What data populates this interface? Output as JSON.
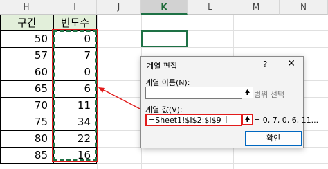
{
  "columns": [
    "H",
    "I",
    "J",
    "K",
    "L",
    "M",
    "N"
  ],
  "selected_column": "K",
  "table": {
    "header": {
      "interval": "구간",
      "frequency": "빈도수"
    },
    "rows": [
      {
        "interval": "50",
        "frequency": "0"
      },
      {
        "interval": "57",
        "frequency": "7"
      },
      {
        "interval": "60",
        "frequency": "0"
      },
      {
        "interval": "65",
        "frequency": "6"
      },
      {
        "interval": "70",
        "frequency": "11"
      },
      {
        "interval": "75",
        "frequency": "34"
      },
      {
        "interval": "80",
        "frequency": "22"
      },
      {
        "interval": "85",
        "frequency": "16"
      }
    ]
  },
  "dialog": {
    "title": "계열 편집",
    "help": "?",
    "close": "✕",
    "series_name_label": "계열 이름(N):",
    "series_name_value": "",
    "series_name_hint": "범위 선택",
    "series_values_label": "계열 값(V):",
    "series_values_value": "=Sheet1!$I$2:$I$9",
    "series_values_preview": "= 0, 7, 0, 6, 11...",
    "ok_label": "확인"
  },
  "colors": {
    "header_fill": "#e2efda",
    "highlight": "#e21b1b",
    "accent": "#1e7145"
  }
}
